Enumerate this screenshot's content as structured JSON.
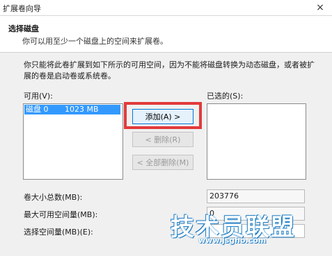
{
  "window": {
    "title": "扩展卷向导",
    "close_glyph": "×"
  },
  "header": {
    "title": "选择磁盘",
    "subtitle": "你可以用至少一个磁盘上的空间来扩展卷。"
  },
  "description": "你只能将此卷扩展到如下所示的可用空间，因为不能将磁盘转换为动态磁盘，或者被扩展的卷是启动卷或系统卷。",
  "available": {
    "label": "可用(V):",
    "items": [
      {
        "name": "磁盘 0",
        "size": "1023 MB",
        "selected": true
      }
    ]
  },
  "selected": {
    "label": "已选的(S):",
    "items": []
  },
  "buttons": {
    "add": "添加(A) >",
    "remove": "< 删除(R)",
    "remove_all": "< 全部删除(M)"
  },
  "fields": {
    "total_label": "卷大小总数(MB):",
    "total_value": "203776",
    "max_label": "最大可用空间量(MB):",
    "max_value": "0",
    "select_label": "选择空间量(MB)(E):",
    "select_value": ""
  },
  "watermark": {
    "text": "技术员联盟",
    "url": "www.jsgho.com"
  },
  "colors": {
    "selection": "#3399ff",
    "highlight_box": "#e23a3a",
    "watermark": "#2a8fd8"
  }
}
